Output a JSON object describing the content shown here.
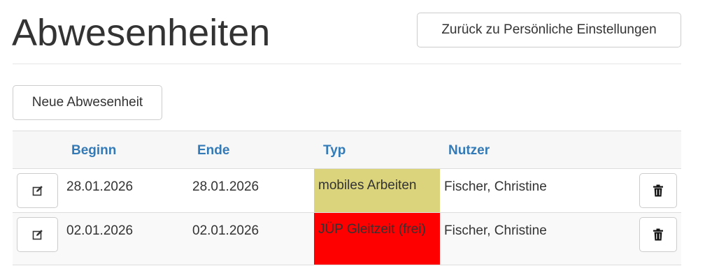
{
  "header": {
    "title": "Abwesenheiten",
    "back_button_label": "Zurück zu Persönliche Einstellungen"
  },
  "actions": {
    "new_button_label": "Neue Abwesenheit"
  },
  "table": {
    "columns": [
      "Beginn",
      "Ende",
      "Typ",
      "Nutzer"
    ],
    "rows": [
      {
        "beginn": "28.01.2026",
        "ende": "28.01.2026",
        "typ": "mobiles Arbeiten",
        "typ_color": "#dbd47d",
        "nutzer": "Fischer, Christine"
      },
      {
        "beginn": "02.01.2026",
        "ende": "02.01.2026",
        "typ": "JÜP Gleitzeit (frei)",
        "typ_color": "#ff0000",
        "nutzer": "Fischer, Christine"
      }
    ]
  },
  "icons": {
    "edit": "edit-icon",
    "delete": "trash-icon"
  }
}
